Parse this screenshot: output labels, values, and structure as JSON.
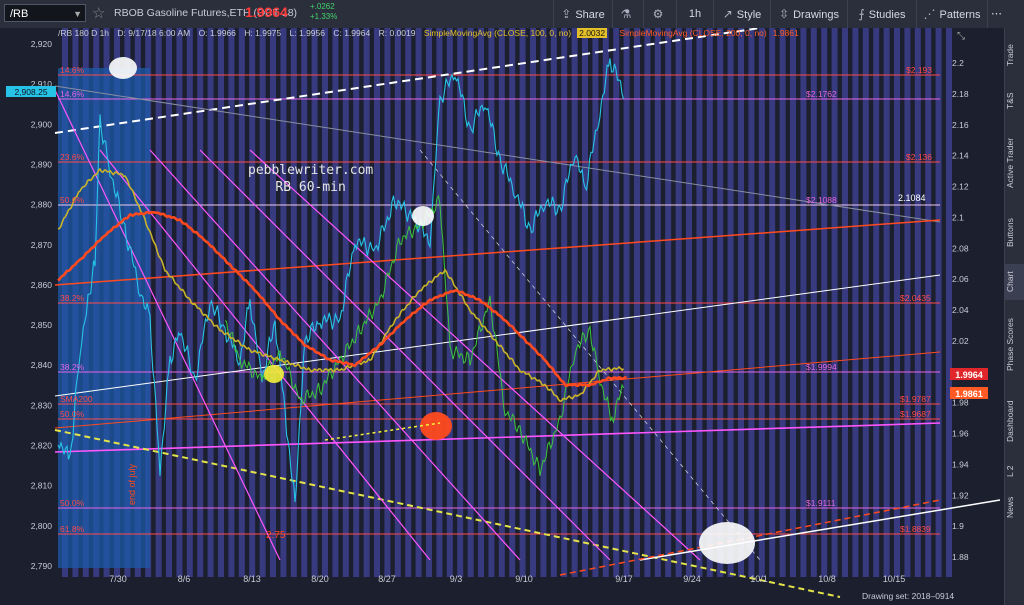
{
  "header": {
    "symbol": "/RB",
    "title": "RBOB Gasoline Futures,ETH (OCT 18)",
    "last": "1.9964",
    "change": "+.0262",
    "change_pct": "+1.33%",
    "buttons": {
      "share": "Share",
      "interval": "1h",
      "style": "Style",
      "drawings": "Drawings",
      "studies": "Studies",
      "patterns": "Patterns"
    }
  },
  "chart_header": {
    "symbol_tf": "/RB 180 D 1h",
    "datetime": "D: 9/17/18 6:00 AM",
    "open": "O: 1.9966",
    "high": "H: 1.9975",
    "low": "L: 1.9956",
    "close": "C: 1.9964",
    "range": "R: 0.0019",
    "sma100": "SimpleMovingAvg (CLOSE, 100, 0, no)",
    "sma100_val": "2.0032",
    "sma200": "SimpleMovingAvg (CLOSE, 200, 0, no)",
    "sma200_val": "1.9861"
  },
  "watermark": {
    "line1": "pebblewriter.com",
    "line2": "RB 60-min"
  },
  "left_axis": {
    "labels": [
      "2,920",
      "2,910",
      "2,900",
      "2,890",
      "2,880",
      "2,870",
      "2,860",
      "2,850",
      "2,840",
      "2,830",
      "2,820",
      "2,810",
      "2,800",
      "2,790"
    ],
    "badge": "2,908.25"
  },
  "right_axis": {
    "labels": [
      "2.2",
      "2.18",
      "2.16",
      "2.14",
      "2.12",
      "2.1",
      "2.08",
      "2.06",
      "2.04",
      "2.02",
      "2",
      "1.98",
      "1.96",
      "1.94",
      "1.92",
      "1.9",
      "1.88"
    ],
    "price_badge": "1.9964",
    "sma_badge": "1.9861"
  },
  "x_axis": {
    "labels": [
      "7/30",
      "8/6",
      "8/13",
      "8/20",
      "8/27",
      "9/3",
      "9/10",
      "9/17",
      "9/24",
      "10/1",
      "10/8",
      "10/15"
    ]
  },
  "level_labels_left": [
    "14.6%",
    "14.6%",
    "23.6%",
    "50.0%",
    "38.2%",
    "38.2%",
    "SMA200",
    "50.0%",
    "50.0%",
    "61.8%"
  ],
  "level_labels_right": [
    "$2.193",
    "$2.1762",
    "$2.136",
    "$2.1088",
    "$2.0435",
    "$1.9994",
    "$1.9787",
    "$1.9687",
    "$1.9111",
    "$1.8839"
  ],
  "other_labels": {
    "level_2108": "2.1084",
    "end_of_july": "end of july",
    "two_75": "2.75"
  },
  "rail": [
    "Trade",
    "T&S",
    "Active Trader",
    "Buttons",
    "Chart",
    "Phase Scores",
    "Dashboard",
    "L 2",
    "News"
  ],
  "footer": "Drawing set: 2018–0914",
  "colors": {
    "bg": "#1b1f2e",
    "stripe": "#3c3f8c",
    "price": "#27c3e6",
    "green": "#3cc43c",
    "sma100": "#c9b32a",
    "sma200": "#ff4a1f"
  }
}
